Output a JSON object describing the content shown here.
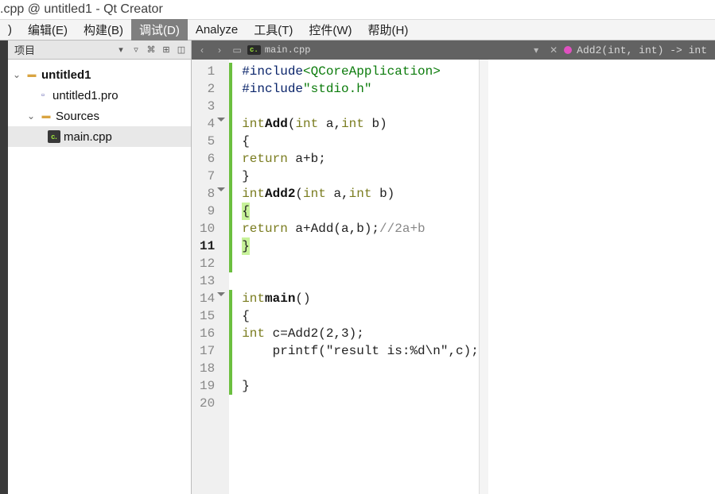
{
  "title": ".cpp @ untitled1 - Qt Creator",
  "menu": {
    "paren": ")",
    "edit": "编辑(E)",
    "build": "构建(B)",
    "debug": "调试(D)",
    "analyze": "Analyze",
    "tools": "工具(T)",
    "widgets": "控件(W)",
    "help": "帮助(H)"
  },
  "project": {
    "header": "项目",
    "root": "untitled1",
    "pro": "untitled1.pro",
    "sources": "Sources",
    "main": "main.cpp"
  },
  "editorToolbar": {
    "file": "main.cpp",
    "symbol": "Add2(int, int) -> int"
  },
  "code": {
    "lines": [
      "#include <QCoreApplication>",
      "#include \"stdio.h\"",
      "",
      "int Add(int a,int b)",
      "{",
      "    return a+b;",
      "}",
      "int Add2(int a,int b)",
      "{",
      "    return a+Add(a,b);//2a+b",
      "}",
      "",
      "",
      "int main()",
      "{",
      "    int c=Add2(2,3);",
      "    printf(\"result is:%d\\n\",c);",
      "",
      "}",
      ""
    ],
    "totalLines": 20,
    "currentLine": 11
  }
}
